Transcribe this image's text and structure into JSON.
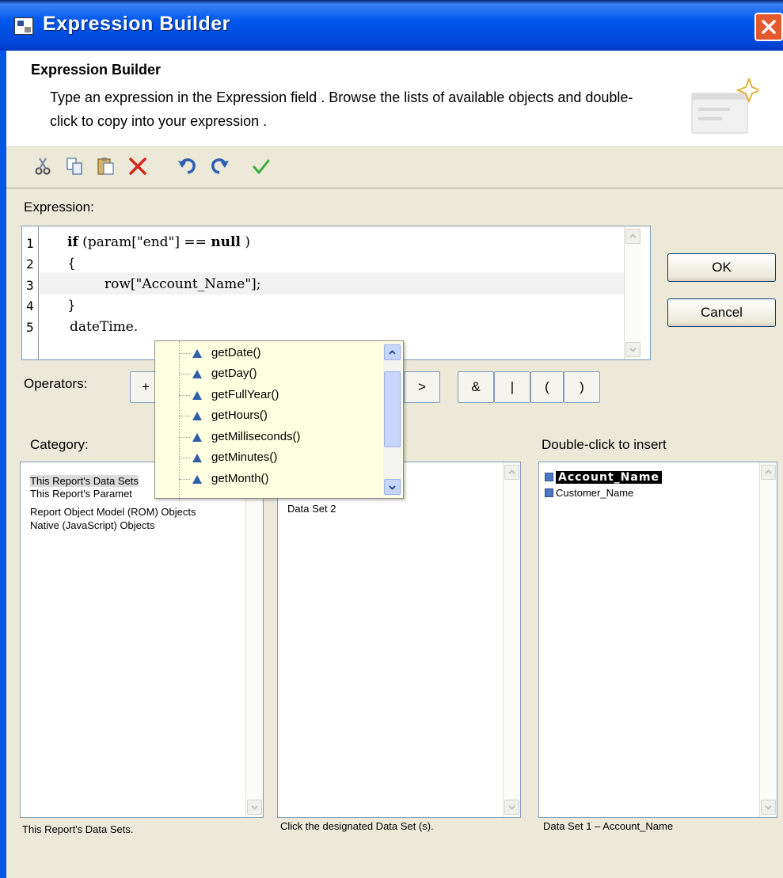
{
  "window": {
    "title": "Expression Builder"
  },
  "header": {
    "title": "Expression Builder",
    "description": "Type an expression in the Expression field . Browse the lists of available objects and double-click to copy into your expression ."
  },
  "toolbar": {
    "icons": [
      "cut-icon",
      "copy-icon",
      "paste-icon",
      "delete-icon",
      "undo-icon",
      "redo-icon",
      "validate-icon"
    ]
  },
  "expression": {
    "label": "Expression:",
    "line_numbers": [
      "1",
      "2",
      "3",
      "4",
      "5"
    ],
    "lines": [
      {
        "kw": "if",
        "rest": " (param[\"end\"] == ",
        "kw2": "null",
        "tail": " )"
      },
      {
        "text": "{"
      },
      {
        "text": "row[\"Account_Name\"];"
      },
      {
        "text": "}"
      },
      {
        "text": "dateTime."
      }
    ]
  },
  "buttons": {
    "ok": "OK",
    "cancel": "Cancel"
  },
  "operators": {
    "label": "Operators:",
    "items": [
      "+",
      ">",
      "&",
      "|",
      "(",
      ")"
    ]
  },
  "autocomplete": [
    "getDate()",
    "getDay()",
    "getFullYear()",
    "getHours()",
    "getMilliseconds()",
    "getMinutes()",
    "getMonth()"
  ],
  "category": {
    "label": "Category:",
    "items": [
      "This Report's Data Sets",
      "This Report's Paramet",
      "Report Object Model (ROM) Objects",
      "Native (JavaScript) Objects"
    ],
    "footer": "This Report's Data Sets."
  },
  "subcategory": {
    "items": [
      "Data Set 2"
    ],
    "footer": "Click the designated Data Set (s)."
  },
  "insert": {
    "label": "Double-click to insert",
    "items": [
      "Account_Name",
      "Customer_Name"
    ],
    "footer": "Data Set 1 – Account_Name"
  }
}
